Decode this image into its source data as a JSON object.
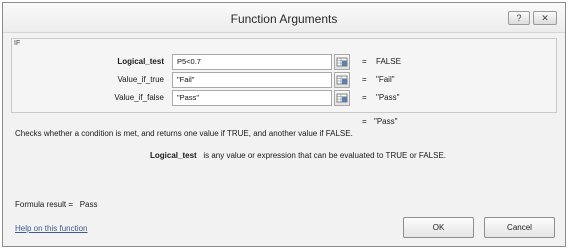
{
  "window": {
    "title": "Function Arguments",
    "help_label": "?",
    "close_label": "✕"
  },
  "function_name": "IF",
  "arguments": [
    {
      "label": "Logical_test",
      "value": "P5<0.7",
      "result": "FALSE",
      "bold": true
    },
    {
      "label": "Value_if_true",
      "value": "\"Fail\"",
      "result": "\"Fail\"",
      "bold": false
    },
    {
      "label": "Value_if_false",
      "value": "\"Pass\"",
      "result": "\"Pass\"",
      "bold": false
    }
  ],
  "equals_sign": "=",
  "function_result": "\"Pass\"",
  "description": "Checks whether a condition is met, and returns one value if TRUE, and another value if FALSE.",
  "argument_help": {
    "name": "Logical_test",
    "text": "is any value or expression that can be evaluated to TRUE or FALSE."
  },
  "formula_result": {
    "label": "Formula result =",
    "value": "Pass"
  },
  "help_link": "Help on this function",
  "buttons": {
    "ok": "OK",
    "cancel": "Cancel"
  },
  "icons": {
    "collapse_dialog": "range-select-icon"
  }
}
